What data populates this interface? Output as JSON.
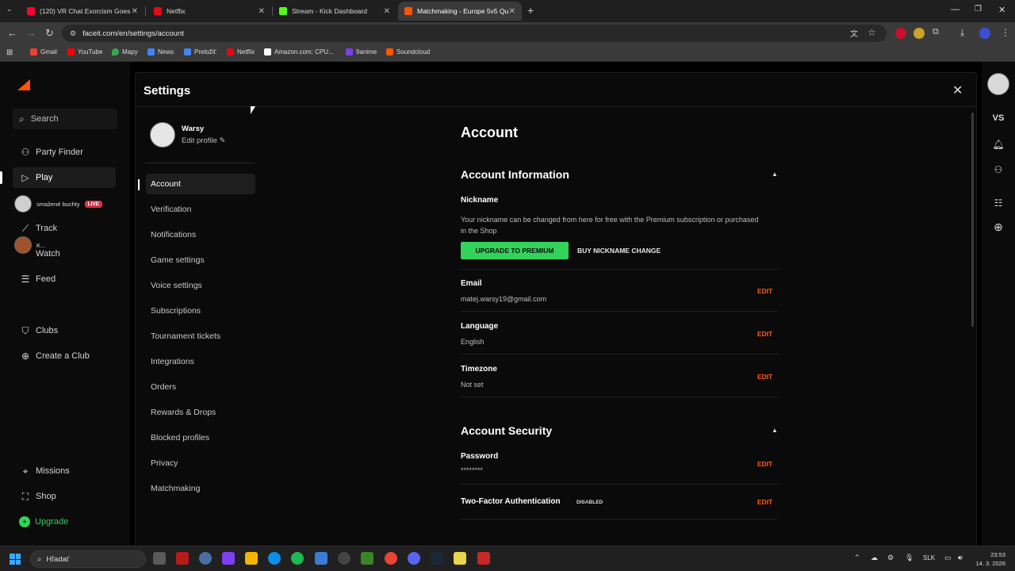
{
  "browser": {
    "tabs": [
      {
        "title": "(120) VR Chat Exorcism Goes Te",
        "color": "#ff0033"
      },
      {
        "title": "Netflix",
        "color": "#e50914"
      },
      {
        "title": "Stream - Kick Dashboard",
        "color": "#53fc18"
      },
      {
        "title": "Matchmaking - Europe 5v5 Qu",
        "color": "#ff5500"
      }
    ],
    "url": "faceit.com/en/settings/account",
    "bookmarks": [
      {
        "label": "Gmail",
        "color": "#ea4335"
      },
      {
        "label": "YouTube",
        "color": "#ff0000"
      },
      {
        "label": "Mapy",
        "color": "#34a853"
      },
      {
        "label": "News",
        "color": "#4285f4"
      },
      {
        "label": "Preložiť",
        "color": "#4285f4"
      },
      {
        "label": "Netflix",
        "color": "#e50914"
      },
      {
        "label": "Amazon.com: CPU...",
        "color": "#ffffff"
      },
      {
        "label": "9anime",
        "color": "#7b3fe4"
      },
      {
        "label": "Soundcloud",
        "color": "#ff5500"
      }
    ]
  },
  "sidebar": {
    "search": "Search",
    "items": [
      {
        "label": "Party Finder",
        "icon": "party-finder-icon"
      },
      {
        "label": "Play",
        "icon": "play-icon"
      },
      {
        "label": "Track",
        "icon": "track-icon"
      },
      {
        "label": "Watch",
        "icon": "watch-icon"
      },
      {
        "label": "Feed",
        "icon": "feed-icon"
      },
      {
        "label": "Clubs",
        "icon": "clubs-icon"
      },
      {
        "label": "Create a Club",
        "icon": "plus-circle-icon"
      },
      {
        "label": "Missions",
        "icon": "missions-icon"
      },
      {
        "label": "Shop",
        "icon": "shop-icon"
      },
      {
        "label": "Upgrade",
        "icon": "upgrade-icon"
      }
    ],
    "stream": {
      "name": "smažené buchty",
      "live": "LIVE"
    },
    "stream2": "K..."
  },
  "rightbar": {
    "vs": "VS"
  },
  "settings": {
    "title": "Settings",
    "profile": {
      "name": "Warsy",
      "edit": "Edit profile"
    },
    "menu": [
      "Account",
      "Verification",
      "Notifications",
      "Game settings",
      "Voice settings",
      "Subscriptions",
      "Tournament tickets",
      "Integrations",
      "Orders",
      "Rewards & Drops",
      "Blocked profiles",
      "Privacy",
      "Matchmaking"
    ],
    "account": {
      "heading": "Account",
      "info_heading": "Account Information",
      "nickname_label": "Nickname",
      "nickname_desc": "Your nickname can be changed from here for free with the Premium subscription or purchased in the Shop",
      "upgrade_btn": "UPGRADE TO PREMIUM",
      "buy_btn": "BUY NICKNAME CHANGE",
      "edit": "EDIT",
      "email_label": "Email",
      "email_value": "matej.warsy19@gmail.com",
      "language_label": "Language",
      "language_value": "English",
      "timezone_label": "Timezone",
      "timezone_value": "Not set",
      "security_heading": "Account Security",
      "password_label": "Password",
      "password_value": "********",
      "twofa_label": "Two-Factor Authentication",
      "twofa_status": "DISABLED"
    }
  },
  "taskbar": {
    "search": "Hľadať",
    "lang": "SLK",
    "time": "23:53",
    "date": "14. 3. 2026"
  },
  "colors": {
    "accent": "#ff5500",
    "premium": "#32d35a",
    "edit": "#ff5a1f",
    "live": "#d6324a"
  }
}
